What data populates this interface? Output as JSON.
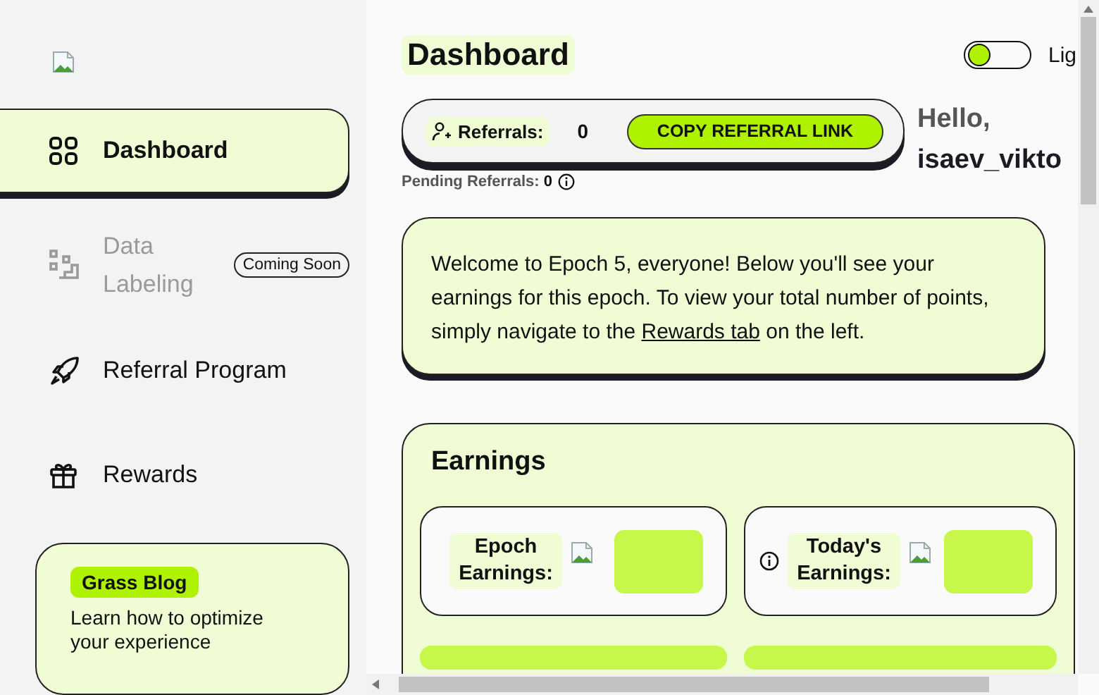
{
  "sidebar": {
    "items": [
      {
        "label": "Dashboard",
        "selected": true,
        "disabled": false
      },
      {
        "label": "Data Labeling",
        "selected": false,
        "disabled": true,
        "badge": "Coming Soon"
      },
      {
        "label": "Referral Program",
        "selected": false,
        "disabled": false
      },
      {
        "label": "Rewards",
        "selected": false,
        "disabled": false
      }
    ],
    "blog": {
      "tag": "Grass Blog",
      "text": "Learn how to optimize your experience"
    }
  },
  "header": {
    "title": "Dashboard",
    "theme_toggle": {
      "on": false,
      "label": "Lig"
    },
    "referrals": {
      "label": "Referrals:",
      "count": "0",
      "button": "COPY REFERRAL LINK",
      "pending_label": "Pending Referrals:",
      "pending_count": "0"
    },
    "greeting": "Hello,",
    "username": "isaev_vikto"
  },
  "welcome": {
    "before": "Welcome to Epoch 5, everyone! Below you'll see your earnings for this epoch. To view your total number of points, simply navigate to the",
    "link": "Rewards tab",
    "after": "on the left."
  },
  "earnings": {
    "title": "Earnings",
    "cards": [
      {
        "label": "Epoch Earnings:",
        "info": false
      },
      {
        "label": "Today's Earnings:",
        "info": true
      }
    ]
  }
}
